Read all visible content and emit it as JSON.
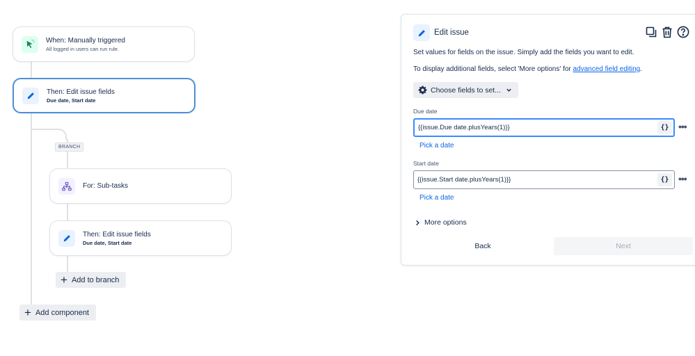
{
  "flow": {
    "trigger": {
      "title": "When: Manually triggered",
      "subtitle": "All logged in users can run rule."
    },
    "action1": {
      "title": "Then: Edit issue fields",
      "subtitle": "Due date, Start date"
    },
    "branch_tag": "BRANCH",
    "branch_for": {
      "title": "For: Sub-tasks"
    },
    "action2": {
      "title": "Then: Edit issue fields",
      "subtitle": "Due date, Start date"
    },
    "add_to_branch_label": "Add to branch",
    "add_component_label": "Add component"
  },
  "panel": {
    "title": "Edit issue",
    "description_1": "Set values for fields on the issue. Simply add the fields you want to edit.",
    "description_2_prefix": "To display additional fields, select 'More options' for ",
    "description_2_link": "advanced field editing",
    "description_2_suffix": ".",
    "choose_fields_label": "Choose fields to set...",
    "fields": [
      {
        "label": "Due date",
        "value": "{{issue.Due date.plusYears(1)}}",
        "smart_value_label": "{}",
        "pick_link": "Pick a date"
      },
      {
        "label": "Start date",
        "value": "{{issue.Start date.plusYears(1)}}",
        "smart_value_label": "{}",
        "pick_link": "Pick a date"
      }
    ],
    "more_options_label": "More options",
    "back_label": "Back",
    "next_label": "Next"
  },
  "icons": {
    "trigger": "cursor-click-icon",
    "edit": "pencil-icon",
    "branch": "hierarchy-icon",
    "duplicate": "copy-icon",
    "delete": "trash-icon",
    "help": "help-icon",
    "settings": "gear-icon"
  },
  "colors": {
    "link": "#0c66e4",
    "selected_border": "#4c8fd6",
    "focus_border": "#388bff",
    "trigger_icon_bg": "#dcfff1",
    "edit_icon_bg": "#e9f2ff",
    "branch_icon_bg": "#f3f0ff"
  }
}
